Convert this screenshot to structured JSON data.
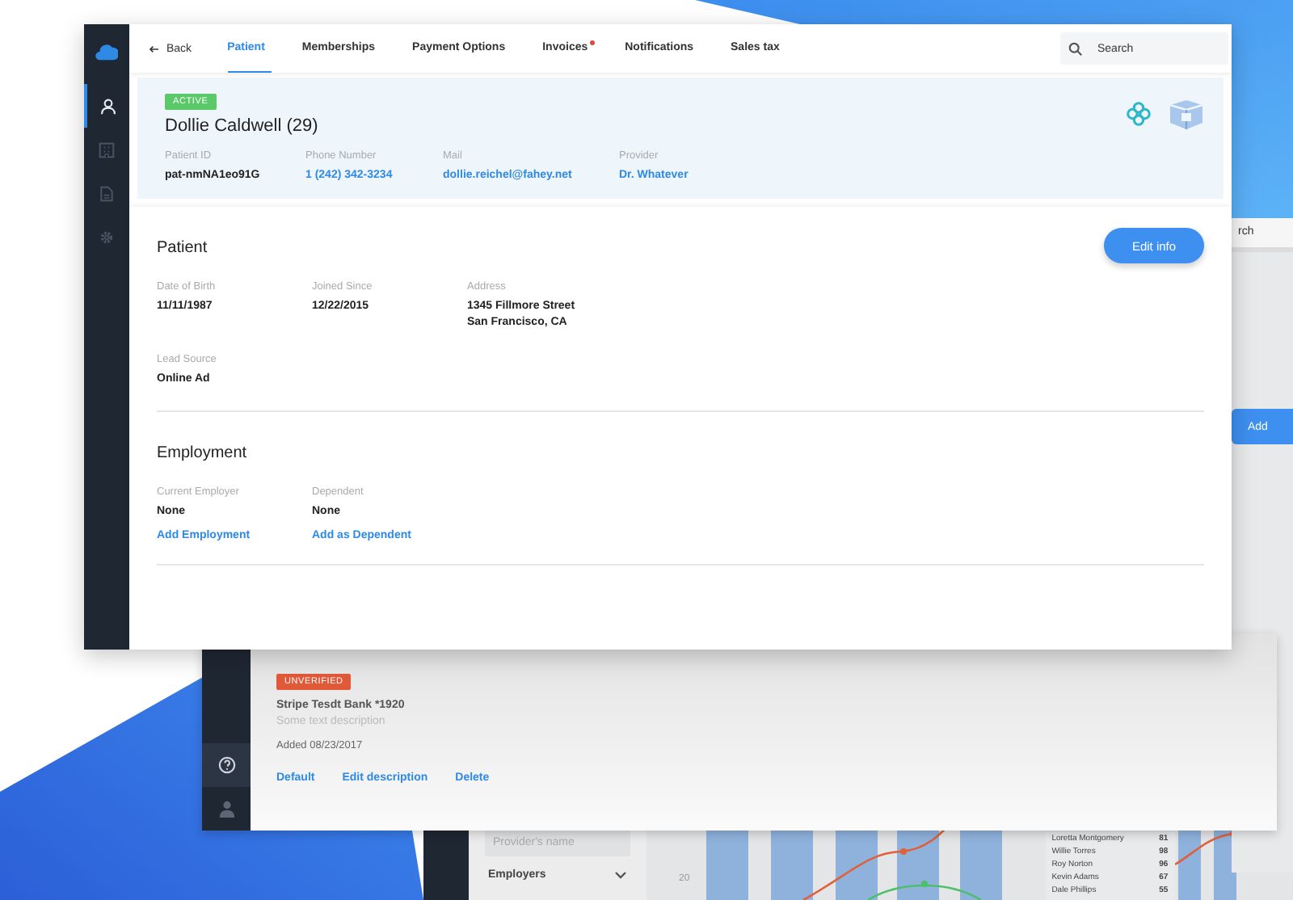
{
  "main_window": {
    "sidebar": [
      {
        "kind": "person",
        "selected": true
      },
      {
        "kind": "building",
        "selected": false
      },
      {
        "kind": "document",
        "selected": false
      },
      {
        "kind": "gear",
        "selected": false
      }
    ],
    "nav": {
      "back": "Back",
      "tabs": [
        {
          "label": "Patient",
          "selected": true,
          "notify": false
        },
        {
          "label": "Memberships",
          "selected": false,
          "notify": false
        },
        {
          "label": "Payment Options",
          "selected": false,
          "notify": false
        },
        {
          "label": "Invoices",
          "selected": false,
          "notify": true
        },
        {
          "label": "Notifications",
          "selected": false,
          "notify": false
        },
        {
          "label": "Sales tax",
          "selected": false,
          "notify": false
        }
      ],
      "search": {
        "placeholder": "Search"
      }
    },
    "header": {
      "status": {
        "label": "ACTIVE",
        "kind": "success"
      },
      "name": "Dollie Caldwell (29)",
      "fields": [
        {
          "label": "Patient ID",
          "value": "pat-nmNA1eo91G",
          "link": false
        },
        {
          "label": "Phone Number",
          "value": "1 (242) 342-3234",
          "link": true
        },
        {
          "label": "Mail",
          "value": "dollie.reichel@fahey.net",
          "link": true
        },
        {
          "label": "Provider",
          "value": "Dr. Whatever",
          "link": true
        }
      ]
    },
    "sections": [
      {
        "title": "Patient",
        "button": "Edit info",
        "rows": [
          [
            {
              "label": "Date of Birth",
              "values": [
                "11/11/1987"
              ]
            },
            {
              "label": "Joined Since",
              "values": [
                "12/22/2015"
              ]
            },
            {
              "label": "Address",
              "values": [
                "1345 Fillmore Street",
                "San Francisco, CA"
              ]
            }
          ],
          [
            {
              "label": "Lead Source",
              "values": [
                "Online Ad"
              ]
            }
          ]
        ]
      },
      {
        "title": "Employment",
        "rows": [
          [
            {
              "label": "Current Employer",
              "values": [
                "None"
              ],
              "action": "Add Employment"
            },
            {
              "label": "Dependent",
              "values": [
                "None"
              ],
              "action": "Add as Dependent"
            }
          ]
        ]
      }
    ]
  },
  "back_window": {
    "sidebar": [
      {
        "kind": "help",
        "selected": true
      },
      {
        "kind": "person",
        "selected": false
      }
    ],
    "card": {
      "status": {
        "label": "UNVERIFIED",
        "kind": "danger"
      },
      "title": "Stripe Tesdt Bank *1920",
      "description": "Some text description",
      "added": "Added 08/23/2017",
      "actions": [
        "Default",
        "Edit description",
        "Delete"
      ]
    }
  },
  "report_window": {
    "filter_placeholder": "Provider's name",
    "filter_group": "Employers",
    "axis_tick": "20",
    "leaderboard": [
      {
        "name": "Loretta Montgomery",
        "score": "81"
      },
      {
        "name": "Willie Torres",
        "score": "98"
      },
      {
        "name": "Roy Norton",
        "score": "96"
      },
      {
        "name": "Kevin Adams",
        "score": "67"
      },
      {
        "name": "Dale Phillips",
        "score": "55"
      }
    ]
  },
  "side_window": {
    "search_partial": "rch",
    "button": "Add"
  }
}
